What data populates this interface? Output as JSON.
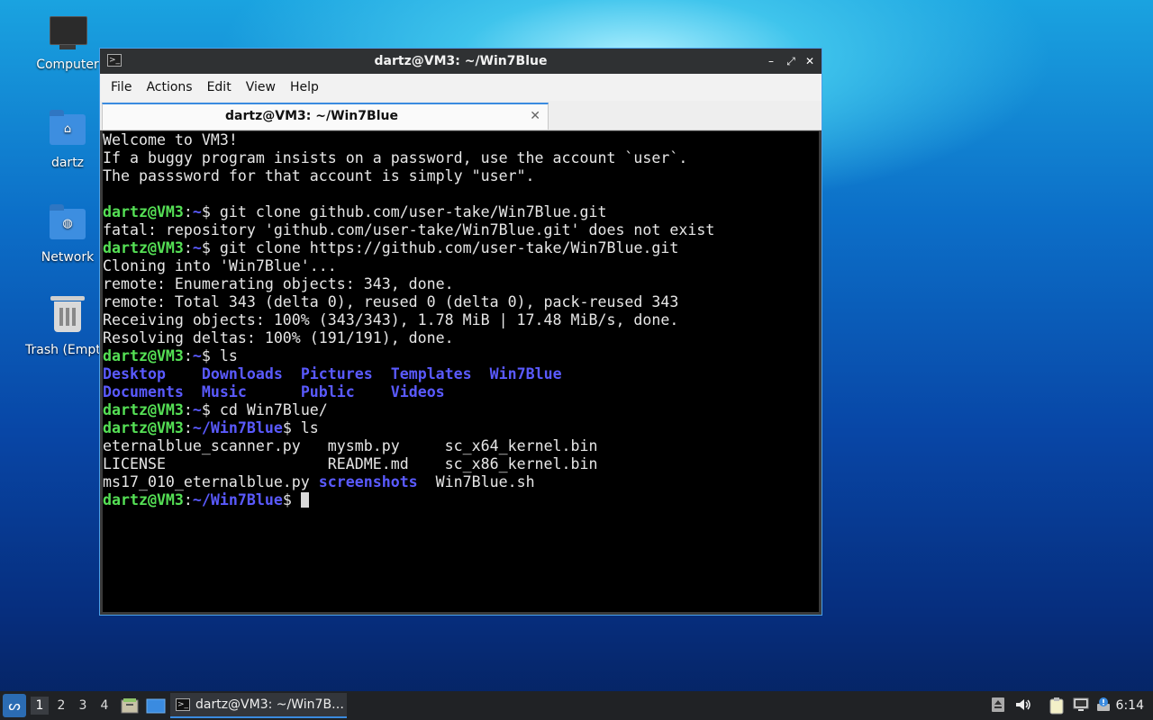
{
  "desktop": {
    "icons": [
      {
        "label": "Computer",
        "icon": "monitor-icon"
      },
      {
        "label": "dartz",
        "icon": "home-folder-icon"
      },
      {
        "label": "Network",
        "icon": "network-folder-icon"
      },
      {
        "label": "Trash (Empt",
        "icon": "trash-icon"
      }
    ]
  },
  "window": {
    "title": "dartz@VM3: ~/Win7Blue",
    "menu": [
      "File",
      "Actions",
      "Edit",
      "View",
      "Help"
    ],
    "tab_label": "dartz@VM3: ~/Win7Blue",
    "controls": {
      "minimize": "–",
      "maximize": "⤢",
      "close": "✕"
    }
  },
  "terminal": {
    "user": "dartz@VM3",
    "lines": [
      "Welcome to VM3!",
      "If a buggy program insists on a password, use the account `user`.",
      "The passsword for that account is simply \"user\".",
      "",
      "fatal: repository 'github.com/user-take/Win7Blue.git' does not exist",
      "Cloning into 'Win7Blue'...",
      "remote: Enumerating objects: 343, done.",
      "remote: Total 343 (delta 0), reused 0 (delta 0), pack-reused 343",
      "Receiving objects: 100% (343/343), 1.78 MiB | 17.48 MiB/s, done.",
      "Resolving deltas: 100% (191/191), done."
    ],
    "prompts": [
      {
        "path": "~",
        "cmd": "$ git clone github.com/user-take/Win7Blue.git"
      },
      {
        "path": "~",
        "cmd": "$ git clone https://github.com/user-take/Win7Blue.git"
      },
      {
        "path": "~",
        "cmd": "$ ls"
      },
      {
        "path": "~",
        "cmd": "$ cd Win7Blue/"
      },
      {
        "path": "~/Win7Blue",
        "cmd": "$ ls"
      },
      {
        "path": "~/Win7Blue",
        "cmd": "$ "
      }
    ],
    "ls_home": [
      "Desktop",
      "Downloads",
      "Pictures",
      "Templates",
      "Win7Blue",
      "Documents",
      "Music",
      "Public",
      "Videos"
    ],
    "ls_repo": [
      "eternalblue_scanner.py",
      "mysmb.py",
      "sc_x64_kernel.bin",
      "LICENSE",
      "README.md",
      "sc_x86_kernel.bin",
      "ms17_010_eternalblue.py",
      "screenshots",
      "Win7Blue.sh"
    ]
  },
  "taskbar": {
    "workspaces": [
      "1",
      "2",
      "3",
      "4"
    ],
    "task_label": "dartz@VM3: ~/Win7B…",
    "clock": "6:14"
  }
}
